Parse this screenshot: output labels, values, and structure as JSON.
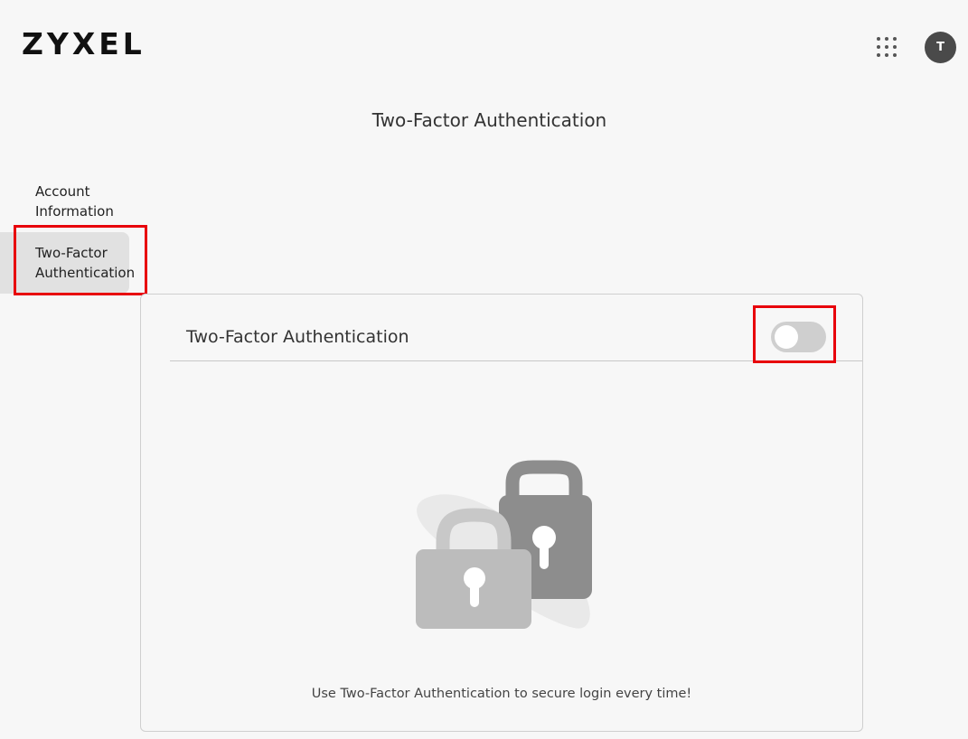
{
  "header": {
    "logo_text": "ZYXEL",
    "apps_icon": "grid-dots-icon",
    "avatar_initial": "T"
  },
  "page": {
    "title": "Two-Factor Authentication"
  },
  "sidebar": {
    "items": [
      {
        "label": "Account Information",
        "active": false
      },
      {
        "label": "Two-Factor Authentication",
        "active": true
      }
    ]
  },
  "card": {
    "title": "Two-Factor Authentication",
    "toggle_on": false,
    "illustration": "padlocks-icon",
    "caption": "Use Two-Factor Authentication to secure login every time!"
  },
  "colors": {
    "highlight": "#e8000b",
    "toggle_off": "#cfcfcf",
    "active_bg": "#e1e1e1"
  }
}
